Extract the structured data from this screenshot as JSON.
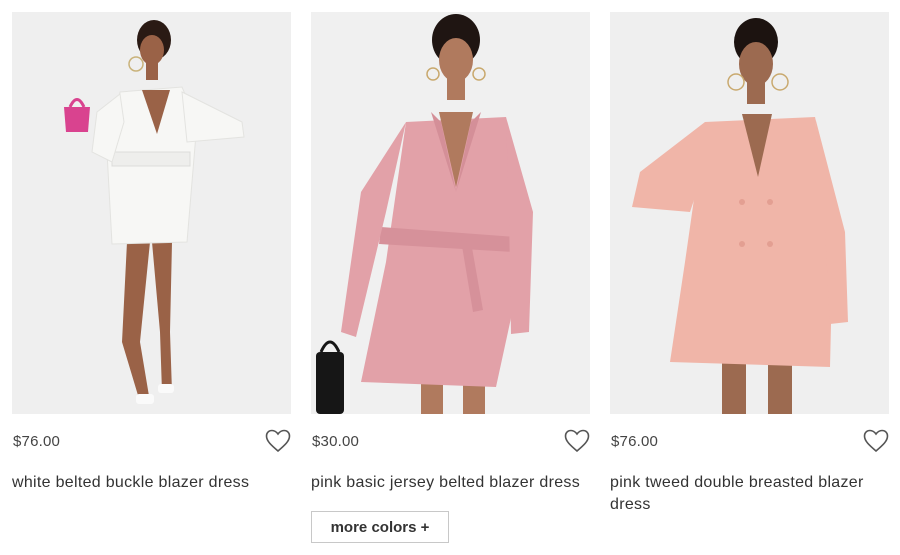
{
  "products": [
    {
      "price": "$76.00",
      "name": "white belted buckle blazer dress",
      "image_desc": "model in white belted blazer dress with pink handbag"
    },
    {
      "price": "$30.00",
      "name": "pink basic jersey belted blazer dress",
      "more_colors_label": "more colors +"
    },
    {
      "price": "$76.00",
      "name": "pink tweed double breasted blazer dress"
    }
  ],
  "colors": {
    "white_dress": "#f7f7f5",
    "pink_dress": "#e2a1a8",
    "tweed_dress": "#f0b5a8",
    "photo_bg": "#efefef",
    "skin": "#9a6247"
  },
  "icons": {
    "wishlist": "heart-outline-icon"
  }
}
